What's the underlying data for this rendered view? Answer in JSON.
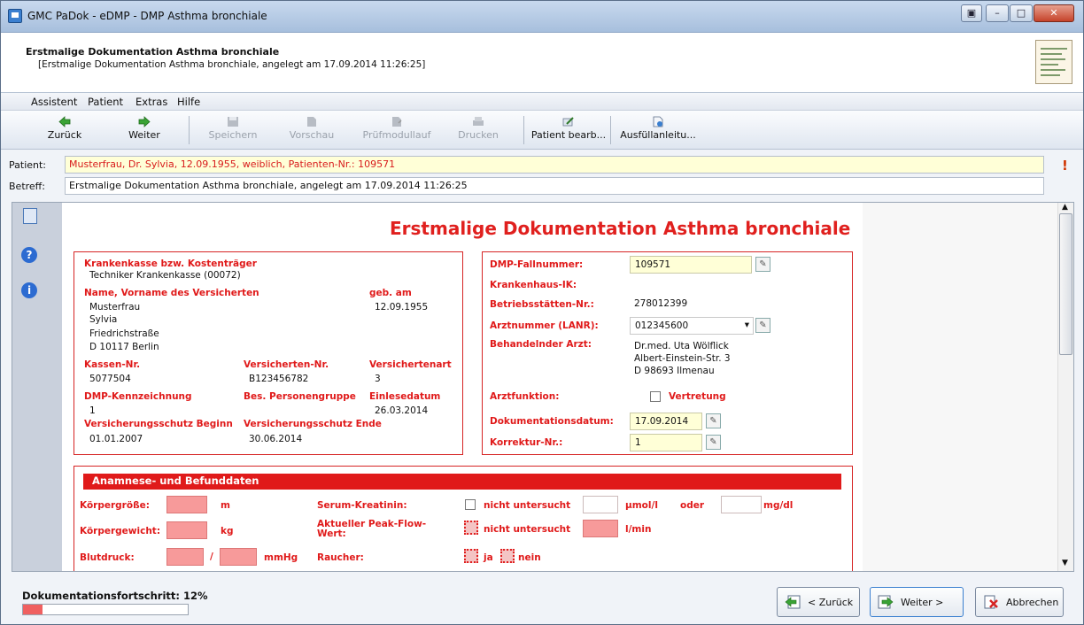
{
  "window": {
    "title": "GMC PaDok  -  eDMP  -  DMP Asthma bronchiale"
  },
  "header": {
    "title": "Erstmalige Dokumentation Asthma bronchiale",
    "subtitle": "[Erstmalige Dokumentation Asthma bronchiale, angelegt am 17.09.2014 11:26:25]"
  },
  "menu": [
    "Assistent",
    "Patient",
    "Extras",
    "Hilfe"
  ],
  "toolbar": {
    "back": "Zurück",
    "next": "Weiter",
    "save": "Speichern",
    "preview": "Vorschau",
    "check": "Prüfmodullauf",
    "print": "Drucken",
    "edit_patient": "Patient bearb...",
    "guide": "Ausfüllanleitu..."
  },
  "patient_row": {
    "patient_label": "Patient:",
    "patient_value": "Musterfrau, Dr. Sylvia,  12.09.1955,  weiblich,  Patienten-Nr.: 109571",
    "betreff_label": "Betreff:",
    "betreff_value": "Erstmalige Dokumentation Asthma bronchiale, angelegt am 17.09.2014 11:26:25"
  },
  "form": {
    "title": "Erstmalige Dokumentation Asthma bronchiale",
    "left": {
      "kk_label": "Krankenkasse bzw. Kostenträger",
      "kk_value": "Techniker Krankenkasse (00072)",
      "name_label": "Name, Vorname des Versicherten",
      "geb_label": "geb. am",
      "name_lines": [
        "Musterfrau",
        "Sylvia",
        "Friedrichstraße",
        "D 10117 Berlin"
      ],
      "geb_value": "12.09.1955",
      "kassen_nr_label": "Kassen-Nr.",
      "kassen_nr_value": "5077504",
      "vers_nr_label": "Versicherten-Nr.",
      "vers_nr_value": "B123456782",
      "vers_art_label": "Versichertenart",
      "vers_art_value": "3",
      "dmp_kz_label": "DMP-Kennzeichnung",
      "dmp_kz_value": "1",
      "pers_gruppe_label": "Bes. Personengruppe",
      "einlese_label": "Einlesedatum",
      "einlese_value": "26.03.2014",
      "vs_beginn_label": "Versicherungsschutz Beginn",
      "vs_beginn_value": "01.01.2007",
      "vs_ende_label": "Versicherungsschutz Ende",
      "vs_ende_value": "30.06.2014"
    },
    "right": {
      "fallnr_label": "DMP-Fallnummer:",
      "fallnr_value": "109571",
      "khik_label": "Krankenhaus-IK:",
      "bsnr_label": "Betriebsstätten-Nr.:",
      "bsnr_value": "278012399",
      "lanr_label": "Arztnummer (LANR):",
      "lanr_value": "012345600",
      "arzt_label": "Behandelnder Arzt:",
      "arzt_lines": [
        "Dr.med. Uta Wölflick",
        "Albert-Einstein-Str. 3",
        "D 98693 Ilmenau"
      ],
      "funktion_label": "Arztfunktion:",
      "vertretung_label": "Vertretung",
      "dokdatum_label": "Dokumentationsdatum:",
      "dokdatum_value": "17.09.2014",
      "korrektur_label": "Korrektur-Nr.:",
      "korrektur_value": "1"
    },
    "anamnese": {
      "title": "Anamnese- und Befunddaten",
      "groesse_label": "Körpergröße:",
      "groesse_unit": "m",
      "gewicht_label": "Körpergewicht:",
      "gewicht_unit": "kg",
      "blutdruck_label": "Blutdruck:",
      "blutdruck_sep": "/",
      "blutdruck_unit": "mmHg",
      "kreatinin_label": "Serum-Kreatinin:",
      "not_examined": "nicht untersucht",
      "umol_unit": "µmol/l",
      "oder": "oder",
      "mgdl_unit": "mg/dl",
      "peakflow_label": "Aktueller Peak-Flow-Wert:",
      "lmin_unit": "l/min",
      "raucher_label": "Raucher:",
      "ja": "ja",
      "nein": "nein"
    }
  },
  "bottom": {
    "progress_label": "Dokumentationsfortschritt:  12%",
    "progress": 0.12,
    "back": "< Zurück",
    "next": "Weiter >",
    "cancel": "Abbrechen"
  },
  "colors": {
    "accent_red": "#e01a1a",
    "patient_text": "#d81b1b",
    "highlight_yellow": "#ffffd7"
  }
}
